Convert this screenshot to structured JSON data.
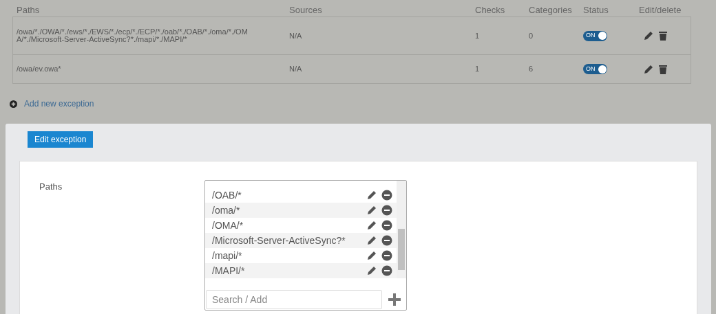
{
  "table": {
    "columns": [
      "Paths",
      "Sources",
      "Checks",
      "Categories",
      "Status",
      "Edit/delete"
    ],
    "rows": [
      {
        "path": "/owa/*./OWA/*./ews/*./EWS/*./ecp/*./ECP/*./oab/*./OAB/*./oma/*./OMA/*./Microsoft-Server-ActiveSync?*./mapi/*./MAPI/*",
        "sources": "N/A",
        "checks": "1",
        "categories": "0",
        "status": {
          "label": "ON",
          "on": true
        }
      },
      {
        "path": "/owa/ev.owa*",
        "sources": "N/A",
        "checks": "1",
        "categories": "6",
        "status": {
          "label": "ON",
          "on": true
        }
      }
    ]
  },
  "add_link": "Add new exception",
  "edit_panel": {
    "title": "Edit exception",
    "paths_label": "Paths",
    "paths": [
      "/OAB/*",
      "/oma/*",
      "/OMA/*",
      "/Microsoft-Server-ActiveSync?*",
      "/mapi/*",
      "/MAPI/*"
    ],
    "search": {
      "placeholder": "Search / Add"
    }
  }
}
